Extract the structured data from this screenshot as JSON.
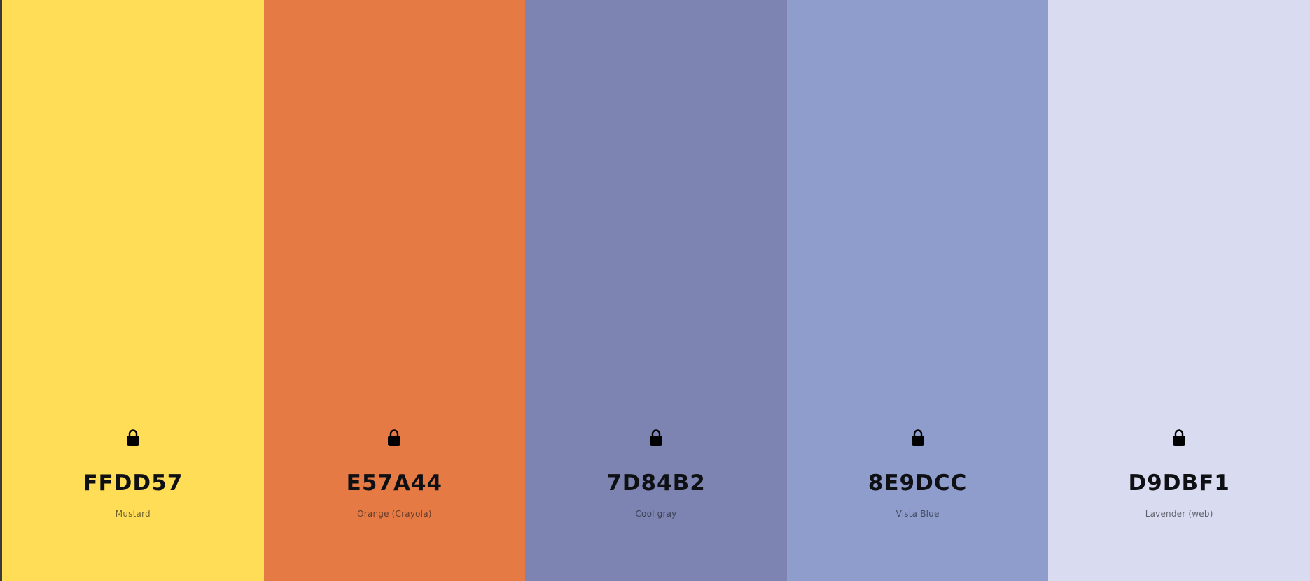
{
  "palette": {
    "swatches": [
      {
        "hex": "FFDD57",
        "name": "Mustard",
        "color": "#FFDD57",
        "icon": "lock-icon"
      },
      {
        "hex": "E57A44",
        "name": "Orange (Crayola)",
        "color": "#E57A44",
        "icon": "lock-icon"
      },
      {
        "hex": "7D84B2",
        "name": "Cool gray",
        "color": "#7D84B2",
        "icon": "lock-icon"
      },
      {
        "hex": "8E9DCC",
        "name": "Vista Blue",
        "color": "#8E9DCC",
        "icon": "lock-icon"
      },
      {
        "hex": "D9DBF1",
        "name": "Lavender (web)",
        "color": "#D9DBF1",
        "icon": "lock-icon"
      }
    ]
  }
}
